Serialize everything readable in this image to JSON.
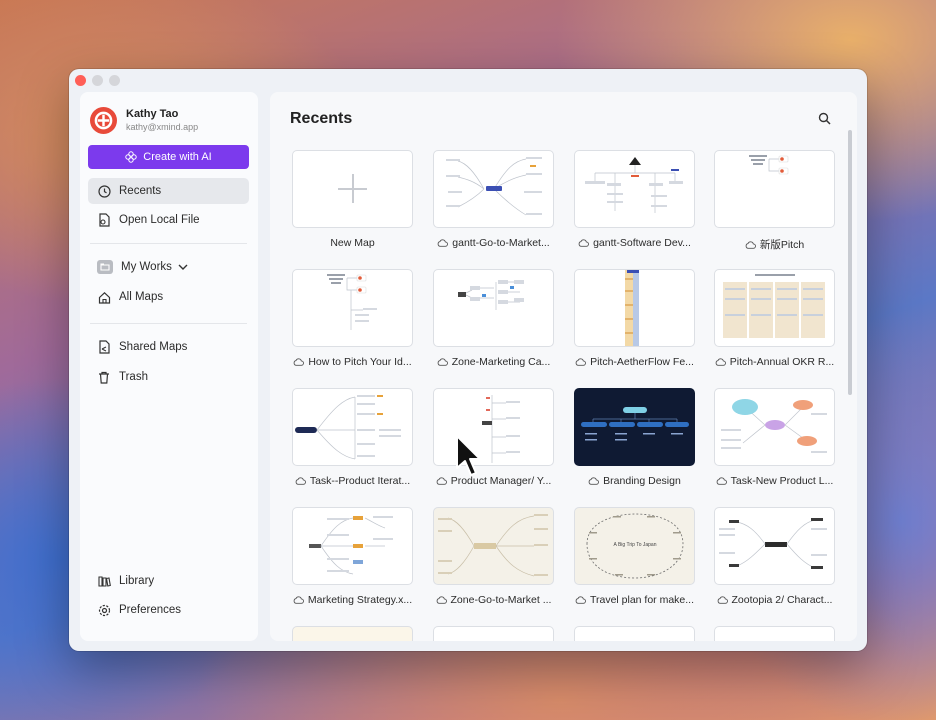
{
  "window": {
    "title": ""
  },
  "user": {
    "name": "Kathy Tao",
    "email": "kathy@xmind.app"
  },
  "sidebar": {
    "create_ai_label": "Create with AI",
    "items": [
      {
        "label": "Recents",
        "icon": "clock-icon"
      },
      {
        "label": "Open Local File",
        "icon": "file-open-icon"
      },
      {
        "label": "My Works",
        "icon": "folder-box-icon"
      },
      {
        "label": "All Maps",
        "icon": "home-icon"
      },
      {
        "label": "Shared Maps",
        "icon": "shared-file-icon"
      },
      {
        "label": "Trash",
        "icon": "trash-icon"
      },
      {
        "label": "Library",
        "icon": "library-icon"
      },
      {
        "label": "Preferences",
        "icon": "gear-icon"
      }
    ]
  },
  "main": {
    "title": "Recents",
    "cards": [
      {
        "label": "New Map",
        "cloud": false
      },
      {
        "label": "gantt-Go-to-Market...",
        "cloud": true
      },
      {
        "label": "gantt-Software Dev...",
        "cloud": true
      },
      {
        "label": "新版Pitch",
        "cloud": true
      },
      {
        "label": "How to Pitch Your Id...",
        "cloud": true
      },
      {
        "label": "Zone-Marketing Ca...",
        "cloud": true
      },
      {
        "label": "Pitch-AetherFlow Fe...",
        "cloud": true
      },
      {
        "label": "Pitch-Annual OKR R...",
        "cloud": true
      },
      {
        "label": "Task--Product Iterat...",
        "cloud": true
      },
      {
        "label": "Product Manager/ Y...",
        "cloud": true
      },
      {
        "label": "Branding Design",
        "cloud": true
      },
      {
        "label": "Task-New Product L...",
        "cloud": true
      },
      {
        "label": "Marketing Strategy.x...",
        "cloud": true
      },
      {
        "label": "Zone-Go-to-Market ...",
        "cloud": true
      },
      {
        "label": "Travel plan for make...",
        "cloud": true
      },
      {
        "label": "Zootopia 2/ Charact...",
        "cloud": true
      }
    ],
    "travel_thumb_title": "A Big Trip To Japan"
  },
  "colors": {
    "accent": "#7c3aed",
    "avatar": "#e84a3a"
  }
}
